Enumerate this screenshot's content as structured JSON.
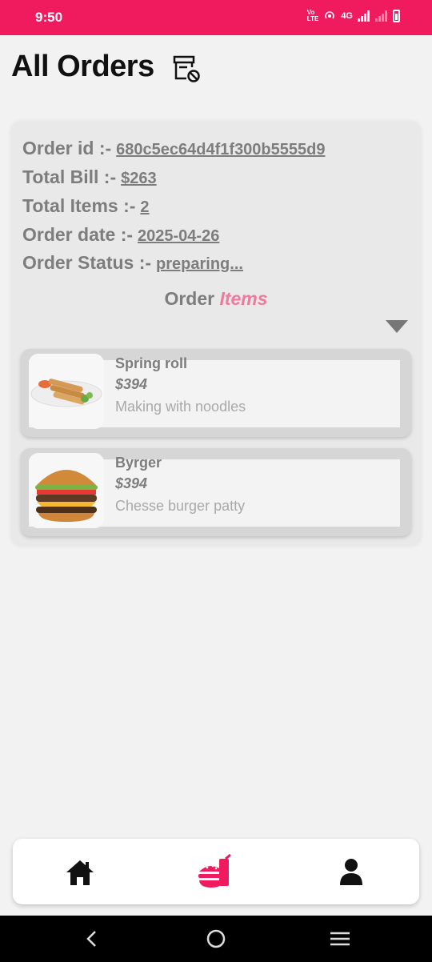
{
  "status_bar": {
    "time": "9:50",
    "network_label": "4G",
    "icons": [
      "volte-icon",
      "hotspot-icon",
      "signal-icon",
      "signal-weak-icon",
      "battery-icon"
    ]
  },
  "header": {
    "title": "All Orders",
    "icon": "cancel-orders-icon"
  },
  "order": {
    "id_label": "Order id :-",
    "id_value": "680c5ec64d4f1f300b5555d9",
    "bill_label": "Total Bill :-",
    "bill_value": "$263",
    "items_label": "Total Items :-",
    "items_value": "2",
    "date_label": "Order date :-",
    "date_value": "2025-04-26",
    "status_label": "Order Status :-",
    "status_value": "preparing...",
    "items_heading_part1": "Order",
    "items_heading_part2": "Items",
    "items": [
      {
        "name": "Spring roll",
        "price": "$394",
        "description": "Making with noodles",
        "image": "spring-roll-image"
      },
      {
        "name": "Byrger",
        "price": "$394",
        "description": "Chesse burger patty",
        "image": "burger-image"
      }
    ]
  },
  "bottom_nav": {
    "items": [
      {
        "icon": "home-icon",
        "active": false
      },
      {
        "icon": "food-order-icon",
        "active": true
      },
      {
        "icon": "user-icon",
        "active": false
      }
    ]
  },
  "colors": {
    "accent": "#ef1b5e",
    "card": "#e9e9e9",
    "muted_text": "#7d7d7d",
    "heading_accent": "#ee7a9c"
  }
}
